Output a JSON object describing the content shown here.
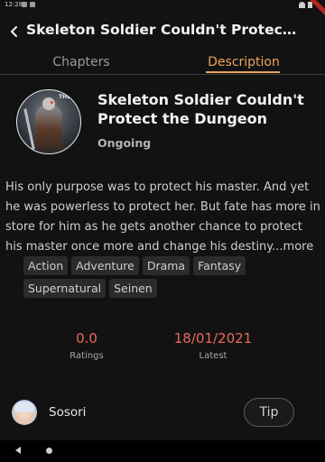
{
  "status_bar": {
    "time": "12:28"
  },
  "app_bar": {
    "back_icon": "back-arrow-icon",
    "title": "Skeleton Soldier Couldn't Protect the ..."
  },
  "tabs": [
    {
      "label": "Chapters",
      "active": false
    },
    {
      "label": "Description",
      "active": true
    }
  ],
  "series": {
    "cover_tag": "THE S",
    "title": "Skeleton Soldier Couldn't Protect the Dungeon",
    "status": "Ongoing",
    "description": "His only purpose was to protect his master. And yet he was powerless to protect her. But fate has more in store for him as he gets another chance to protect his master once more and change his destiny...more",
    "genres": [
      "Action",
      "Adventure",
      "Drama",
      "Fantasy",
      "Supernatural",
      "Seinen"
    ]
  },
  "stats": {
    "ratings_value": "0.0",
    "ratings_label": "Ratings",
    "latest_value": "18/01/2021",
    "latest_label": "Latest"
  },
  "uploader": {
    "name": "Sosori",
    "tip_label": "Tip"
  },
  "colors": {
    "background": "#121212",
    "accent": "#f0a35a",
    "stat_value": "#e86a5c"
  }
}
